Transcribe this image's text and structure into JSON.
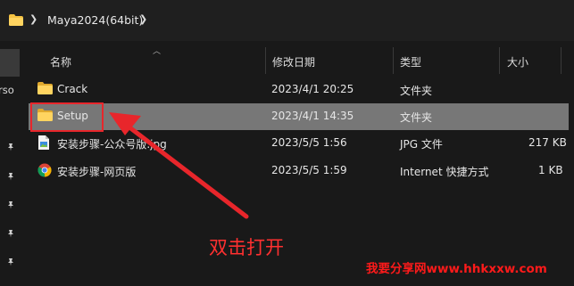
{
  "breadcrumb": {
    "path": "Maya2024(64bit)"
  },
  "nav": {
    "partial_label": "rso"
  },
  "columns": {
    "name": "名称",
    "modified": "修改日期",
    "type": "类型",
    "size": "大小"
  },
  "files": [
    {
      "name": "Crack",
      "modified": "2023/4/1 20:25",
      "type": "文件夹",
      "size": "",
      "icon": "folder-icon"
    },
    {
      "name": "Setup",
      "modified": "2023/4/1 14:35",
      "type": "文件夹",
      "size": "",
      "icon": "folder-icon"
    },
    {
      "name": "安装步骤-公众号版.jpg",
      "modified": "2023/5/5 1:56",
      "type": "JPG 文件",
      "size": "217 KB",
      "icon": "image-file-icon"
    },
    {
      "name": "安装步骤-网页版",
      "modified": "2023/5/5 1:59",
      "type": "Internet 快捷方式",
      "size": "1 KB",
      "icon": "chrome-shortcut-icon"
    }
  ],
  "annotation": {
    "text": "双击打开"
  },
  "watermark": {
    "text": "我要分享网www.hhkxxw.com"
  },
  "colors": {
    "accent_red": "#e8262b",
    "folder_yellow": "#f5c242",
    "selection": "#777777"
  }
}
